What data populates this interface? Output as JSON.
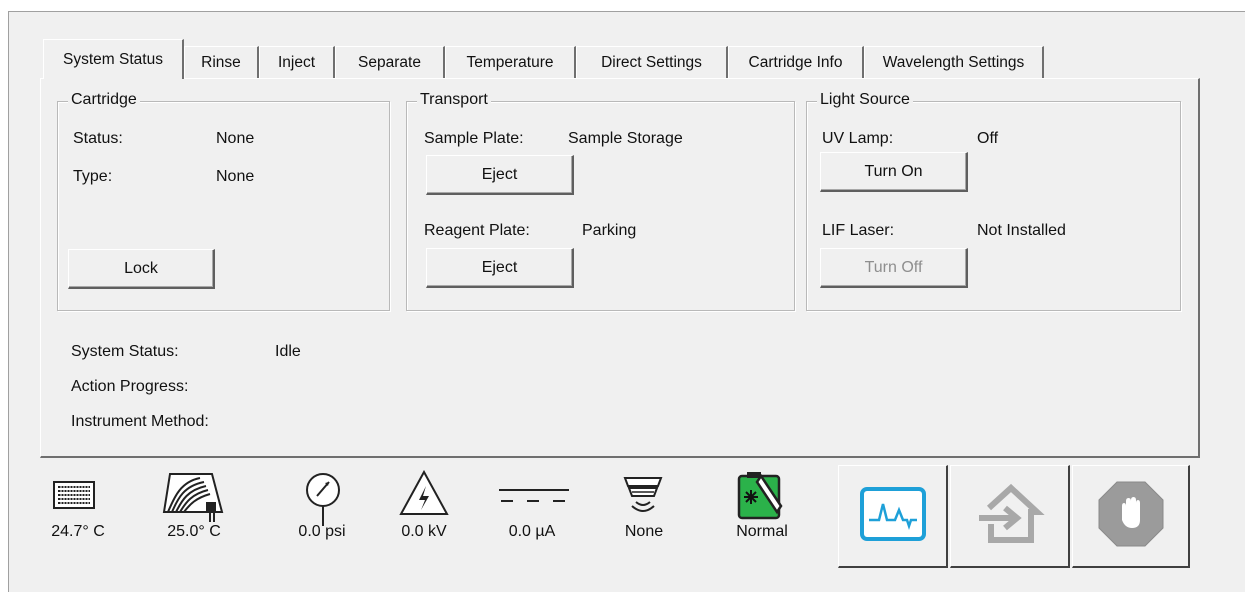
{
  "tabs": [
    {
      "label": "System Status",
      "active": true
    },
    {
      "label": "Rinse"
    },
    {
      "label": "Inject"
    },
    {
      "label": "Separate"
    },
    {
      "label": "Temperature"
    },
    {
      "label": "Direct Settings"
    },
    {
      "label": "Cartridge Info"
    },
    {
      "label": "Wavelength Settings"
    }
  ],
  "cartridge": {
    "title": "Cartridge",
    "status_label": "Status:",
    "status_value": "None",
    "type_label": "Type:",
    "type_value": "None",
    "lock_button": "Lock"
  },
  "transport": {
    "title": "Transport",
    "sample_plate_label": "Sample Plate:",
    "sample_plate_value": "Sample Storage",
    "sample_eject_button": "Eject",
    "reagent_plate_label": "Reagent Plate:",
    "reagent_plate_value": "Parking",
    "reagent_eject_button": "Eject"
  },
  "light_source": {
    "title": "Light Source",
    "uv_lamp_label": "UV Lamp:",
    "uv_lamp_value": "Off",
    "uv_button": "Turn On",
    "lif_label": "LIF Laser:",
    "lif_value": "Not Installed",
    "lif_button": "Turn Off"
  },
  "system": {
    "status_label": "System Status:",
    "status_value": "Idle",
    "progress_label": "Action Progress:",
    "method_label": "Instrument Method:"
  },
  "status_bar": [
    {
      "icon": "sample-plate-icon",
      "value": "24.7° C"
    },
    {
      "icon": "cartridge-coolant-icon",
      "value": "25.0° C"
    },
    {
      "icon": "pressure-gauge-icon",
      "value": "0.0 psi"
    },
    {
      "icon": "high-voltage-icon",
      "value": "0.0 kV"
    },
    {
      "icon": "current-icon",
      "value": "0.0 µA"
    },
    {
      "icon": "detector-icon",
      "value": "None"
    },
    {
      "icon": "coolant-bottle-icon",
      "value": "Normal"
    }
  ],
  "colors": {
    "accent": "#1ea0d8",
    "coolant_green": "#2bb24a",
    "stop_gray": "#9b9b9b"
  }
}
